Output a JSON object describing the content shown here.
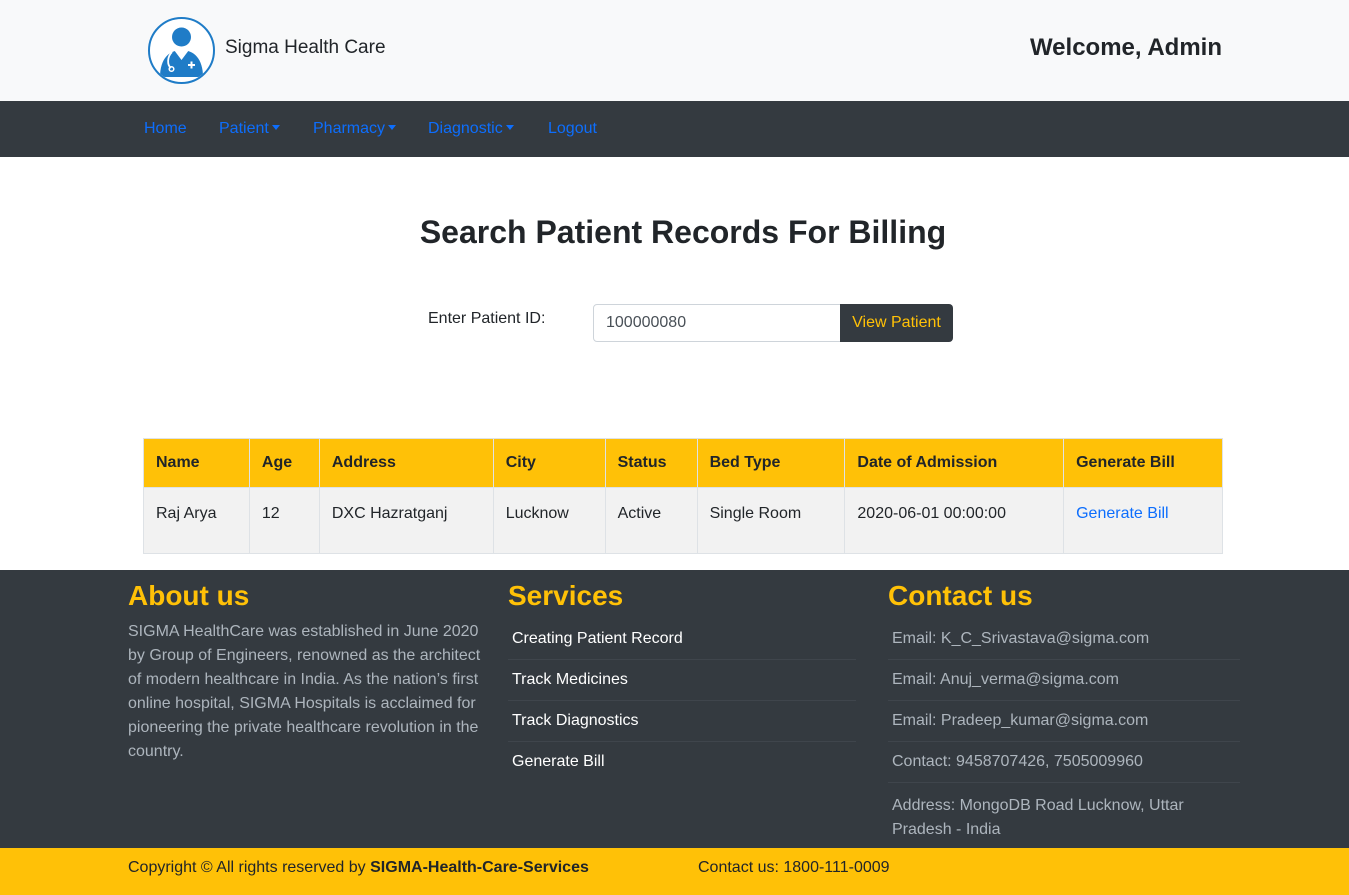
{
  "header": {
    "brand": "Sigma Health Care",
    "welcome": "Welcome, Admin",
    "logo_icon": "doctor-avatar-icon"
  },
  "nav": {
    "items": [
      {
        "label": "Home",
        "dropdown": false
      },
      {
        "label": "Patient",
        "dropdown": true
      },
      {
        "label": "Pharmacy",
        "dropdown": true
      },
      {
        "label": "Diagnostic",
        "dropdown": true
      },
      {
        "label": "Logout",
        "dropdown": false
      }
    ]
  },
  "main": {
    "title": "Search Patient Records For Billing",
    "patient_id_label": "Enter Patient ID:",
    "patient_id_value": "100000080",
    "view_button": "View Patient"
  },
  "table": {
    "headers": [
      "Name",
      "Age",
      "Address",
      "City",
      "Status",
      "Bed Type",
      "Date of Admission",
      "Generate Bill"
    ],
    "rows": [
      {
        "name": "Raj Arya",
        "age": "12",
        "address": "DXC Hazratganj",
        "city": "Lucknow",
        "status": "Active",
        "bed_type": "Single Room",
        "date": "2020-06-01 00:00:00",
        "action": "Generate Bill"
      }
    ]
  },
  "footer": {
    "about_title": "About us",
    "about_text": "SIGMA HealthCare was established in June 2020 by Group of Engineers, renowned as the architect of modern healthcare in India. As the nation’s first online hospital, SIGMA Hospitals is acclaimed for pioneering the private healthcare revolution in the country.",
    "services_title": "Services",
    "services": [
      "Creating Patient Record",
      "Track Medicines",
      "Track Diagnostics",
      "Generate Bill"
    ],
    "contact_title": "Contact us",
    "contacts": [
      "Email: K_C_Srivastava@sigma.com",
      "Email: Anuj_verma@sigma.com",
      "Email: Pradeep_kumar@sigma.com",
      "Contact: 9458707426, 7505009960",
      "Address: MongoDB Road Lucknow, Uttar Pradesh - India"
    ],
    "copyright_prefix": "Copyright © All rights reserved by",
    "copyright_org": "SIGMA-Health-Care-Services",
    "contact_us": "Contact us: 1800-111-0009"
  },
  "colors": {
    "accent": "#ffc107",
    "dark": "#343a40",
    "link": "#0d6efd",
    "header_bg": "#f8f9fa"
  }
}
